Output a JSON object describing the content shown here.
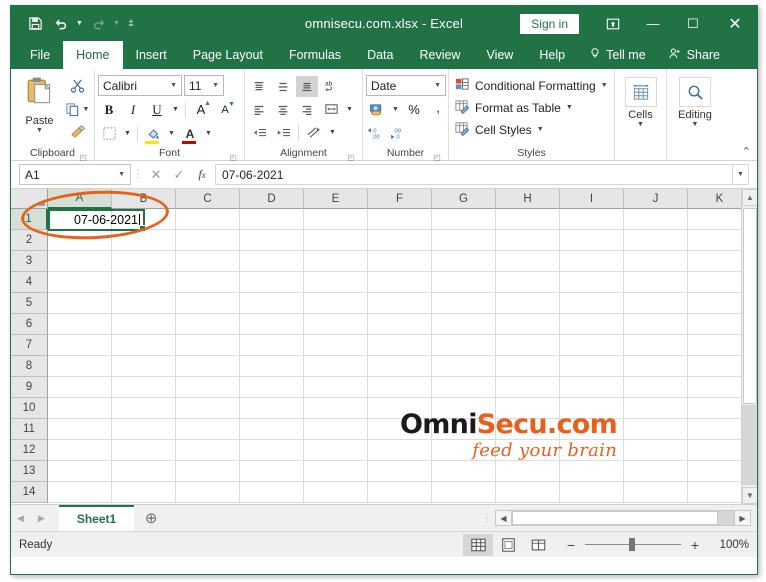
{
  "window": {
    "title": "omnisecu.com.xlsx  -  Excel",
    "signin_label": "Sign in",
    "ribbon_display_icon": "ribbon-display-options-icon",
    "minimize_glyph": "—",
    "maximize_glyph": "☐",
    "close_glyph": "✕"
  },
  "qat": {
    "save": "save-icon",
    "undo": "undo-icon",
    "redo": "redo-icon",
    "customize": "customize-quick-access-toolbar-icon"
  },
  "tabs": [
    {
      "label": "File",
      "active": false
    },
    {
      "label": "Home",
      "active": true
    },
    {
      "label": "Insert",
      "active": false
    },
    {
      "label": "Page Layout",
      "active": false
    },
    {
      "label": "Formulas",
      "active": false
    },
    {
      "label": "Data",
      "active": false
    },
    {
      "label": "Review",
      "active": false
    },
    {
      "label": "View",
      "active": false
    },
    {
      "label": "Help",
      "active": false
    }
  ],
  "tab_right": {
    "tell_me": "Tell me",
    "share": "Share"
  },
  "ribbon": {
    "groups": [
      {
        "label": "Clipboard"
      },
      {
        "label": "Font"
      },
      {
        "label": "Alignment"
      },
      {
        "label": "Number"
      },
      {
        "label": "Styles"
      },
      {
        "label": "Cells"
      },
      {
        "label": "Editing"
      }
    ],
    "clipboard": {
      "paste_label": "Paste",
      "cut": "cut-scissors-icon",
      "copy": "copy-icon",
      "format_painter": "format-painter-icon"
    },
    "font": {
      "font_name": "Calibri",
      "font_size": "11",
      "bold": "B",
      "italic": "I",
      "underline": "U",
      "grow_font": "A",
      "shrink_font": "A",
      "borders": "borders-icon",
      "fill_color": "fill-color-icon",
      "font_color": "font-color-icon"
    },
    "alignment": {
      "top_align": "align-top-icon",
      "middle_align": "align-middle-icon",
      "bottom_align": "align-bottom-icon",
      "orientation": "text-orientation-icon",
      "align_left": "align-left-icon",
      "align_center": "align-center-icon",
      "align_right": "align-right-icon",
      "wrap_text": "wrap-text-icon",
      "decrease_indent": "decrease-indent-icon",
      "increase_indent": "increase-indent-icon",
      "merge_center": "merge-and-center-icon"
    },
    "number": {
      "format": "Date",
      "accounting": "accounting-number-format-icon",
      "percent": "%",
      "comma": ",",
      "increase_decimal": "increase-decimal-icon",
      "decrease_decimal": "decrease-decimal-icon"
    },
    "styles": {
      "conditional_formatting": "Conditional Formatting",
      "format_as_table": "Format as Table",
      "cell_styles": "Cell Styles"
    },
    "cells": {
      "label": "Cells"
    },
    "editing": {
      "label": "Editing"
    }
  },
  "formula_bar": {
    "name_box": "A1",
    "cancel": "cancel-icon",
    "enter": "confirm-icon",
    "insert_function": "fx",
    "value": "07-06-2021"
  },
  "grid": {
    "columns": [
      "A",
      "B",
      "C",
      "D",
      "E",
      "F",
      "G",
      "H",
      "I",
      "J",
      "K"
    ],
    "rows": [
      "1",
      "2",
      "3",
      "4",
      "5",
      "6",
      "7",
      "8",
      "9",
      "10",
      "11",
      "12",
      "13",
      "14"
    ],
    "active_cell": {
      "ref": "A1",
      "value": "07-06-2021"
    },
    "watermark": {
      "part1": "Omni",
      "part2": "Secu.com",
      "tagline": "feed your brain",
      "color_dark": "#1a1a1a",
      "color_accent": "#e8601c"
    },
    "annotation": {
      "shape": "ellipse",
      "color": "#e8601c"
    }
  },
  "sheet_bar": {
    "prev": "previous-sheet-icon",
    "next": "next-sheet-icon",
    "tabs": [
      {
        "label": "Sheet1",
        "active": true
      }
    ],
    "add": "add-sheet-icon"
  },
  "status_bar": {
    "status": "Ready",
    "views": [
      {
        "name": "normal-view",
        "selected": true
      },
      {
        "name": "page-layout-view",
        "selected": false
      },
      {
        "name": "page-break-preview",
        "selected": false
      }
    ],
    "zoom_out": "−",
    "zoom_in": "+",
    "zoom_level": "100%"
  },
  "colors": {
    "excel_green": "#217346",
    "accent_orange": "#e8601c",
    "ribbon_bg": "#ffffff"
  }
}
